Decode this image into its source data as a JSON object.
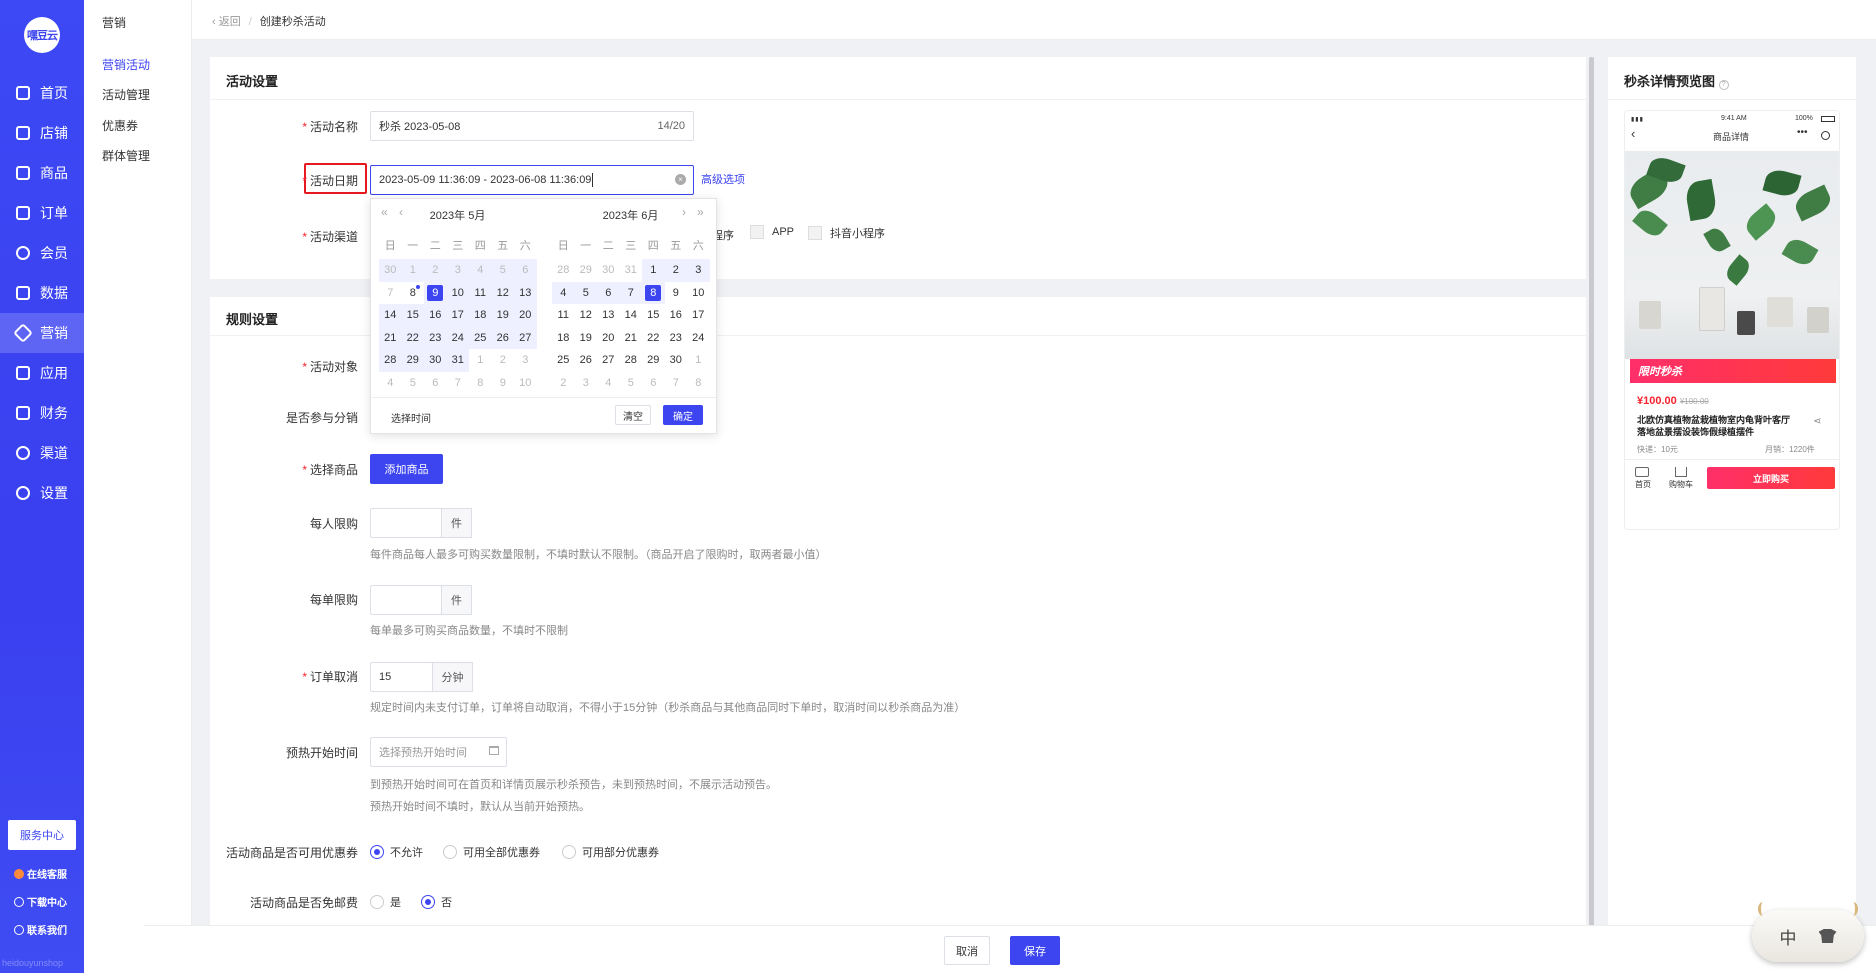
{
  "sidebar": {
    "logo": "嘿豆云",
    "nav": [
      {
        "label": "首页",
        "icon": "home-icon"
      },
      {
        "label": "店铺",
        "icon": "store-icon"
      },
      {
        "label": "商品",
        "icon": "goods-icon"
      },
      {
        "label": "订单",
        "icon": "order-icon"
      },
      {
        "label": "会员",
        "icon": "user-icon"
      },
      {
        "label": "数据",
        "icon": "chart-icon"
      },
      {
        "label": "营销",
        "icon": "tag-icon",
        "active": true
      },
      {
        "label": "应用",
        "icon": "app-icon"
      },
      {
        "label": "财务",
        "icon": "finance-icon"
      },
      {
        "label": "渠道",
        "icon": "channel-icon"
      },
      {
        "label": "设置",
        "icon": "gear-icon"
      }
    ],
    "service_center": "服务中心",
    "links": [
      "在线客服",
      "下载中心",
      "联系我们"
    ],
    "footer": "heidouyunshop"
  },
  "submenu": {
    "title": "营销",
    "items": [
      "营销活动",
      "活动管理",
      "优惠券",
      "群体管理"
    ]
  },
  "breadcrumb": {
    "back": "返回",
    "current": "创建秒杀活动"
  },
  "activity": {
    "section_title": "活动设置",
    "name_label": "活动名称",
    "name_value": "秒杀 2023-05-08",
    "name_count": "14/20",
    "date_label": "活动日期",
    "date_value": "2023-05-09 11:36:09 - 2023-06-08 11:36:09",
    "advanced": "高级选项",
    "channel_label": "活动渠道",
    "channels": [
      "程序",
      "APP",
      "抖音小程序"
    ]
  },
  "picker": {
    "left_title": "2023年 5月",
    "right_title": "2023年 6月",
    "weekdays": [
      "日",
      "一",
      "二",
      "三",
      "四",
      "五",
      "六"
    ],
    "select_time": "选择时间",
    "clear": "清空",
    "confirm": "确定"
  },
  "rules": {
    "section_title": "规则设置",
    "target_label": "活动对象",
    "distribution_label": "是否参与分销",
    "goods_label": "选择商品",
    "add_goods": "添加商品",
    "per_person_label": "每人限购",
    "per_person_unit": "件",
    "per_person_hint": "每件商品每人最多可购买数量限制，不填时默认不限制。（商品开启了限购时，取两者最小值）",
    "per_order_label": "每单限购",
    "per_order_unit": "件",
    "per_order_hint": "每单最多可购买商品数量，不填时不限制",
    "cancel_label": "订单取消",
    "cancel_value": "15",
    "cancel_unit": "分钟",
    "cancel_hint": "规定时间内未支付订单，订单将自动取消，不得小于15分钟（秒杀商品与其他商品同时下单时，取消时间以秒杀商品为准）",
    "preheat_label": "预热开始时间",
    "preheat_placeholder": "选择预热开始时间",
    "preheat_hint1": "到预热开始时间可在首页和详情页展示秒杀预告，未到预热时间，不展示活动预告。",
    "preheat_hint2": "预热开始时间不填时，默认从当前开始预热。",
    "coupon_label": "活动商品是否可用优惠券",
    "coupon_options": [
      "不允许",
      "可用全部优惠券",
      "可用部分优惠券"
    ],
    "shipping_label": "活动商品是否免邮费",
    "shipping_options": [
      "是",
      "否"
    ]
  },
  "preview": {
    "title": "秒杀详情预览图",
    "status_time": "9:41 AM",
    "status_battery": "100%",
    "page_title": "商品详情",
    "flash_tag": "限时秒杀",
    "price": "¥100.00",
    "orig_price": "¥100.00",
    "product_name": "北欧仿真植物盆栽植物室内龟背叶客厅落地盆景摆设装饰假绿植摆件",
    "shipping": "快递：10元",
    "monthly_sales": "月销：1220件",
    "home": "首页",
    "cart": "购物车",
    "buy_now": "立即购买"
  },
  "footer": {
    "cancel": "取消",
    "save": "保存"
  },
  "ime": {
    "lang": "中"
  }
}
